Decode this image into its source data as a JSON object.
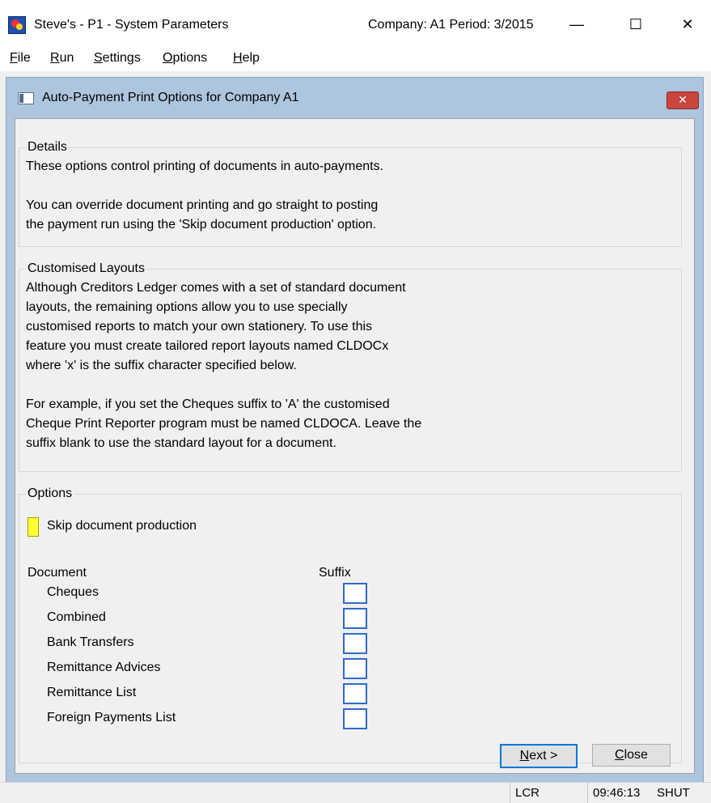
{
  "window": {
    "title": "Steve's - P1 - System Parameters",
    "company_period": "Company: A1  Period:  3/2015",
    "controls": {
      "minimize": "—",
      "maximize": "☐",
      "close": "✕"
    }
  },
  "menu": [
    {
      "key": "F",
      "rest": "ile"
    },
    {
      "key": "R",
      "rest": "un"
    },
    {
      "key": "S",
      "rest": "ettings"
    },
    {
      "key": "O",
      "rest": "ptions"
    },
    {
      "key": "H",
      "rest": "elp"
    }
  ],
  "dialog": {
    "title": "Auto-Payment Print Options for Company A1",
    "close_glyph": "✕",
    "details": {
      "legend": "Details",
      "line1": "These options control printing of documents in auto-payments.",
      "line2": "You can override document printing and go straight to posting",
      "line3": "the payment run using the 'Skip document production' option."
    },
    "customised": {
      "legend": "Customised Layouts",
      "lines": [
        "Although Creditors Ledger comes with a set of standard  document",
        "layouts, the remaining options allow you to use specially",
        "customised reports to match your own stationery.  To use this",
        "feature you must create tailored report layouts named CLDOCx",
        "where 'x' is the suffix character specified below."
      ],
      "lines2": [
        "For example, if you set the Cheques suffix to 'A' the customised",
        "Cheque Print Reporter program must be named CLDOCA. Leave the",
        "suffix blank to use  the standard layout for a document."
      ]
    },
    "options": {
      "legend": "Options",
      "skip_label": "Skip document production",
      "document_header": "Document",
      "suffix_header": "Suffix",
      "documents": [
        "Cheques",
        "Combined",
        "Bank Transfers",
        "Remittance Advices",
        "Remittance List",
        "Foreign Payments List"
      ]
    },
    "buttons": {
      "next_key": "N",
      "next_rest": "ext >",
      "close_key": "C",
      "close_rest": "lose"
    }
  },
  "statusbar": {
    "mode": "LCR",
    "time": "09:46:13",
    "state": "SHUT"
  }
}
